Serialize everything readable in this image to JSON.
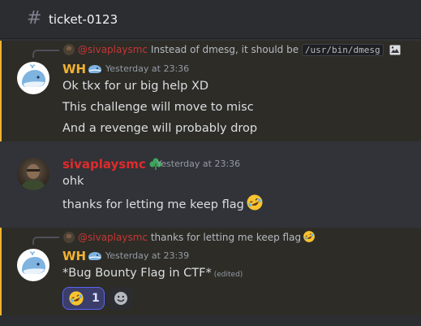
{
  "channel": {
    "hash": "#",
    "name": "ticket-0123"
  },
  "messages": [
    {
      "reply": {
        "author": "@sivaplaysmc",
        "text": "Instead of dmesg, it should be",
        "code": "/usr/bin/dmesg"
      },
      "author": "WH",
      "author_emoji": "whale-emoji",
      "timestamp": "Yesterday at 23:36",
      "lines": [
        "Ok tkx for ur big help XD",
        "This challenge will move to misc",
        "And a revenge will probably drop"
      ]
    },
    {
      "author": "sivaplaysmc",
      "author_badge": "clover-badge-icon",
      "timestamp": "Yesterday at 23:36",
      "lines": [
        "ohk",
        "thanks for letting me keep flag"
      ]
    },
    {
      "reply": {
        "author": "@sivaplaysmc",
        "text": "thanks for letting me keep flag"
      },
      "author": "WH",
      "author_emoji": "whale-emoji",
      "timestamp": "Yesterday at 23:39",
      "lines": [
        "*Bug Bounty Flag in CTF*"
      ],
      "edited": "(edited)",
      "reaction": {
        "emoji": "rolling-on-floor-laughing-emoji",
        "count": "1"
      }
    }
  ],
  "colors": {
    "accent_gold": "#f0b232",
    "name_red": "#e02b2b",
    "reaction_border": "#5865f2"
  }
}
